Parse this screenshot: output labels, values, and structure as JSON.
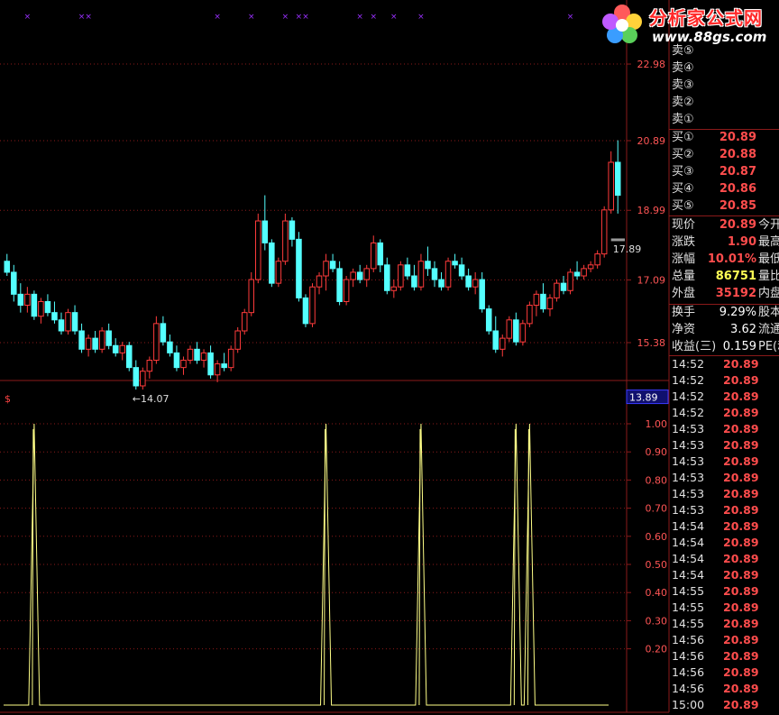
{
  "logo": {
    "title": "分析家公式网",
    "url": "www.88gs.com"
  },
  "price_axis": {
    "ticks": [
      "22.98",
      "20.89",
      "18.99",
      "17.09",
      "15.38"
    ],
    "current_marker": "13.89"
  },
  "indicator_axis": {
    "ticks": [
      "1.00",
      "0.90",
      "0.80",
      "0.70",
      "0.60",
      "0.50",
      "0.40",
      "0.30",
      "0.20"
    ]
  },
  "annotations": {
    "low_label": "←14.07",
    "last_label": "17.89",
    "indicator_symbol": "$"
  },
  "colors": {
    "up": "#ff3b3b",
    "down": "#54ffff",
    "grid": "#8b1a1a",
    "signal": "#ffff88",
    "marker": "#9b30ff",
    "panel_bg": "#000000"
  },
  "chart_data": {
    "type": "candlestick",
    "ylim": [
      13.89,
      22.98
    ],
    "candles": [
      [
        17.6,
        17.8,
        17.2,
        17.3
      ],
      [
        17.3,
        17.5,
        16.5,
        16.7
      ],
      [
        16.7,
        17.0,
        16.2,
        16.4
      ],
      [
        16.4,
        16.9,
        16.2,
        16.7
      ],
      [
        16.7,
        16.8,
        16.0,
        16.1
      ],
      [
        16.1,
        16.6,
        15.9,
        16.5
      ],
      [
        16.5,
        16.7,
        16.1,
        16.2
      ],
      [
        16.2,
        16.5,
        15.9,
        16.0
      ],
      [
        16.0,
        16.2,
        15.6,
        15.7
      ],
      [
        15.7,
        16.3,
        15.6,
        16.2
      ],
      [
        16.2,
        16.4,
        15.6,
        15.7
      ],
      [
        15.7,
        15.9,
        15.1,
        15.2
      ],
      [
        15.2,
        15.6,
        15.0,
        15.5
      ],
      [
        15.5,
        15.7,
        15.1,
        15.2
      ],
      [
        15.2,
        15.8,
        15.1,
        15.7
      ],
      [
        15.7,
        15.9,
        15.2,
        15.3
      ],
      [
        15.3,
        15.5,
        15.0,
        15.1
      ],
      [
        15.1,
        15.4,
        14.9,
        15.3
      ],
      [
        15.3,
        15.4,
        14.6,
        14.7
      ],
      [
        14.7,
        14.9,
        14.1,
        14.2
      ],
      [
        14.2,
        14.7,
        14.1,
        14.6
      ],
      [
        14.6,
        15.0,
        14.4,
        14.9
      ],
      [
        14.9,
        16.1,
        14.8,
        15.9
      ],
      [
        15.9,
        16.1,
        15.3,
        15.4
      ],
      [
        15.4,
        15.6,
        15.0,
        15.1
      ],
      [
        15.1,
        15.3,
        14.6,
        14.7
      ],
      [
        14.7,
        15.0,
        14.5,
        14.9
      ],
      [
        14.9,
        15.3,
        14.8,
        15.2
      ],
      [
        15.2,
        15.4,
        14.8,
        14.9
      ],
      [
        14.9,
        15.2,
        14.7,
        15.1
      ],
      [
        15.1,
        15.3,
        14.4,
        14.5
      ],
      [
        14.5,
        14.9,
        14.3,
        14.8
      ],
      [
        14.8,
        15.1,
        14.6,
        14.7
      ],
      [
        14.7,
        15.3,
        14.6,
        15.2
      ],
      [
        15.2,
        15.8,
        15.1,
        15.7
      ],
      [
        15.7,
        16.3,
        15.6,
        16.2
      ],
      [
        16.2,
        17.3,
        16.1,
        17.1
      ],
      [
        17.1,
        18.9,
        17.0,
        18.7
      ],
      [
        18.7,
        19.4,
        17.9,
        18.1
      ],
      [
        18.1,
        18.2,
        16.9,
        17.0
      ],
      [
        17.0,
        17.7,
        16.9,
        17.6
      ],
      [
        17.6,
        18.9,
        17.5,
        18.7
      ],
      [
        18.7,
        18.8,
        18.0,
        18.2
      ],
      [
        18.2,
        18.4,
        16.5,
        16.6
      ],
      [
        16.6,
        16.7,
        15.8,
        15.9
      ],
      [
        15.9,
        17.0,
        15.8,
        16.9
      ],
      [
        16.9,
        17.3,
        16.7,
        17.2
      ],
      [
        17.2,
        17.8,
        16.8,
        17.6
      ],
      [
        17.6,
        17.8,
        17.3,
        17.4
      ],
      [
        17.4,
        17.6,
        16.4,
        16.5
      ],
      [
        16.5,
        17.2,
        16.4,
        17.1
      ],
      [
        17.1,
        17.4,
        16.9,
        17.3
      ],
      [
        17.3,
        17.5,
        17.0,
        17.1
      ],
      [
        17.1,
        17.5,
        16.9,
        17.4
      ],
      [
        17.4,
        18.3,
        17.3,
        18.1
      ],
      [
        18.1,
        18.2,
        17.3,
        17.5
      ],
      [
        17.5,
        17.7,
        16.7,
        16.8
      ],
      [
        16.8,
        17.1,
        16.6,
        16.9
      ],
      [
        16.9,
        17.6,
        16.8,
        17.5
      ],
      [
        17.5,
        17.7,
        17.1,
        17.2
      ],
      [
        17.2,
        17.5,
        16.8,
        16.9
      ],
      [
        16.9,
        17.8,
        16.8,
        17.6
      ],
      [
        17.6,
        18.0,
        17.2,
        17.4
      ],
      [
        17.4,
        17.6,
        16.9,
        17.1
      ],
      [
        17.1,
        17.3,
        16.8,
        16.9
      ],
      [
        16.9,
        17.7,
        16.8,
        17.6
      ],
      [
        17.6,
        17.8,
        17.4,
        17.5
      ],
      [
        17.5,
        17.7,
        17.1,
        17.2
      ],
      [
        17.2,
        17.4,
        16.8,
        16.9
      ],
      [
        16.9,
        17.3,
        16.7,
        17.1
      ],
      [
        17.1,
        17.3,
        16.2,
        16.3
      ],
      [
        16.3,
        16.4,
        15.6,
        15.7
      ],
      [
        15.7,
        16.1,
        15.1,
        15.2
      ],
      [
        15.2,
        15.6,
        15.0,
        15.5
      ],
      [
        15.5,
        16.1,
        15.4,
        16.0
      ],
      [
        16.0,
        16.2,
        15.3,
        15.4
      ],
      [
        15.4,
        16.0,
        15.3,
        15.9
      ],
      [
        15.9,
        16.5,
        15.8,
        16.4
      ],
      [
        16.4,
        16.8,
        16.1,
        16.7
      ],
      [
        16.7,
        17.0,
        16.2,
        16.3
      ],
      [
        16.3,
        16.7,
        16.1,
        16.6
      ],
      [
        16.6,
        17.1,
        16.5,
        17.0
      ],
      [
        17.0,
        17.2,
        16.7,
        16.8
      ],
      [
        16.8,
        17.4,
        16.7,
        17.3
      ],
      [
        17.3,
        17.6,
        17.1,
        17.2
      ],
      [
        17.2,
        17.5,
        17.1,
        17.4
      ],
      [
        17.4,
        17.6,
        17.3,
        17.5
      ],
      [
        17.5,
        17.9,
        17.4,
        17.8
      ],
      [
        17.8,
        19.1,
        17.7,
        19.0
      ],
      [
        19.0,
        20.6,
        18.9,
        20.3
      ],
      [
        20.3,
        20.9,
        18.9,
        19.4
      ]
    ],
    "signals": [
      {
        "index": 4,
        "value": 1.0
      },
      {
        "index": 47,
        "value": 1.0
      },
      {
        "index": 61,
        "value": 1.0
      },
      {
        "index": 75,
        "value": 1.0
      },
      {
        "index": 77,
        "value": 1.0
      }
    ],
    "top_markers": [
      3,
      11,
      12,
      31,
      36,
      41,
      43,
      44,
      52,
      54,
      57,
      61,
      83
    ]
  },
  "side": {
    "sell": [
      {
        "label": "卖⑤",
        "value": ""
      },
      {
        "label": "卖④",
        "value": ""
      },
      {
        "label": "卖③",
        "value": ""
      },
      {
        "label": "卖②",
        "value": ""
      },
      {
        "label": "卖①",
        "value": ""
      }
    ],
    "buy": [
      {
        "label": "买①",
        "value": "20.89"
      },
      {
        "label": "买②",
        "value": "20.88"
      },
      {
        "label": "买③",
        "value": "20.87"
      },
      {
        "label": "买④",
        "value": "20.86"
      },
      {
        "label": "买⑤",
        "value": "20.85"
      }
    ],
    "stats": [
      {
        "label": "现价",
        "value": "20.89",
        "ext": "今开"
      },
      {
        "label": "涨跌",
        "value": "1.90",
        "ext": "最高"
      },
      {
        "label": "涨幅",
        "value": "10.01%",
        "ext": "最低"
      },
      {
        "label": "总量",
        "value": "86751",
        "ext": "量比"
      },
      {
        "label": "外盘",
        "value": "35192",
        "ext": "内盘"
      }
    ],
    "fund": [
      {
        "label": "换手",
        "value": "9.29%",
        "ext": "股本"
      },
      {
        "label": "净资",
        "value": "3.62",
        "ext": "流通"
      },
      {
        "label": "收益(三)",
        "value": "0.159",
        "ext": "PE(动"
      }
    ],
    "ticks": [
      {
        "time": "14:52",
        "price": "20.89"
      },
      {
        "time": "14:52",
        "price": "20.89"
      },
      {
        "time": "14:52",
        "price": "20.89"
      },
      {
        "time": "14:52",
        "price": "20.89"
      },
      {
        "time": "14:53",
        "price": "20.89"
      },
      {
        "time": "14:53",
        "price": "20.89"
      },
      {
        "time": "14:53",
        "price": "20.89"
      },
      {
        "time": "14:53",
        "price": "20.89"
      },
      {
        "time": "14:53",
        "price": "20.89"
      },
      {
        "time": "14:53",
        "price": "20.89"
      },
      {
        "time": "14:54",
        "price": "20.89"
      },
      {
        "time": "14:54",
        "price": "20.89"
      },
      {
        "time": "14:54",
        "price": "20.89"
      },
      {
        "time": "14:54",
        "price": "20.89"
      },
      {
        "time": "14:55",
        "price": "20.89"
      },
      {
        "time": "14:55",
        "price": "20.89"
      },
      {
        "time": "14:55",
        "price": "20.89"
      },
      {
        "time": "14:56",
        "price": "20.89"
      },
      {
        "time": "14:56",
        "price": "20.89"
      },
      {
        "time": "14:56",
        "price": "20.89"
      },
      {
        "time": "14:56",
        "price": "20.89"
      },
      {
        "time": "15:00",
        "price": "20.89"
      }
    ]
  }
}
